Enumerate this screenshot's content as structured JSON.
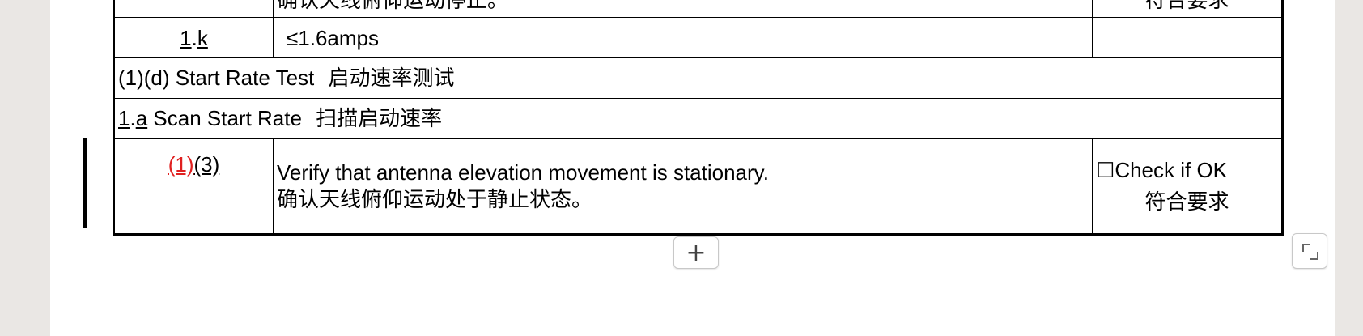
{
  "table": {
    "prev_row": {
      "step": "",
      "text_zh": "确认天线俯仰运动停止。",
      "check_zh": "符合要求"
    },
    "row_k": {
      "step_a": "1",
      "step_sep": ".",
      "step_b": "k",
      "text": "≤1.6amps",
      "check": ""
    },
    "section_heading": {
      "en": "(1)(d) Start Rate Test",
      "zh": "启动速率测试"
    },
    "sub_heading": {
      "num_a": "1",
      "num_sep": ".",
      "num_b": "a",
      "en": " Scan Start Rate",
      "zh": "扫描启动速率"
    },
    "main_row": {
      "step_red": "(1)",
      "step_black": "(3)",
      "text_en": "Verify that antenna elevation movement is stationary.",
      "text_zh": "确认天线俯仰运动处于静止状态。",
      "check_box": "☐",
      "check_en": "Check if OK",
      "check_zh": "符合要求"
    }
  },
  "controls": {
    "add_row_label": "+",
    "resize_icon": "resize-corner-icon"
  },
  "colors": {
    "page_bg": "#eae7e4",
    "sheet": "#ffffff",
    "revision_red": "#e02020"
  }
}
